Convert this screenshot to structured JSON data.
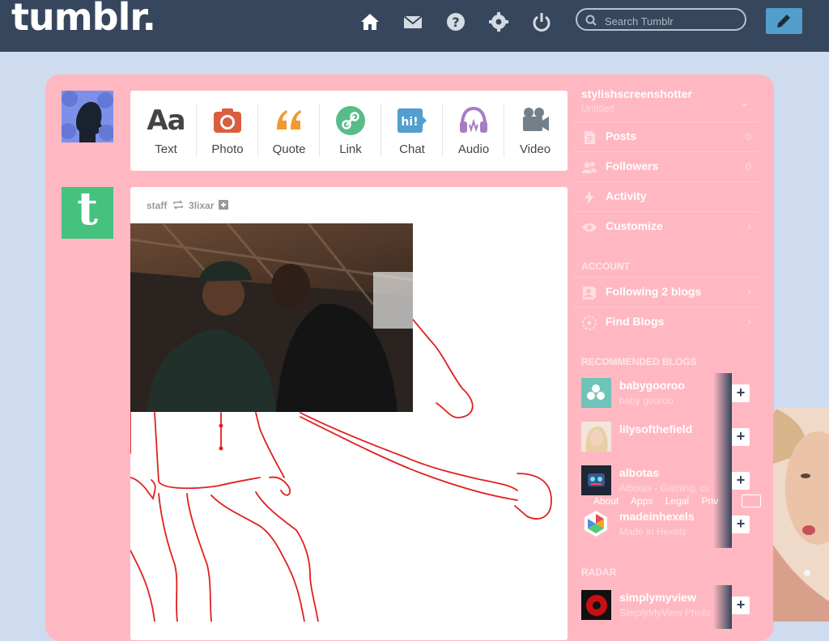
{
  "header": {
    "logo": "tumblr.",
    "nav_icons": [
      "home-icon",
      "mail-icon",
      "help-icon",
      "gear-icon",
      "power-icon"
    ],
    "search_placeholder": "Search Tumblr",
    "compose_icon": "pencil-icon"
  },
  "post_types": [
    {
      "label": "Text",
      "icon": "Aa",
      "color": "#444444"
    },
    {
      "label": "Photo",
      "icon": "camera-icon",
      "color": "#d95e40"
    },
    {
      "label": "Quote",
      "icon": "quote-icon",
      "color": "#f2992e"
    },
    {
      "label": "Link",
      "icon": "link-icon",
      "color": "#56bc8a"
    },
    {
      "label": "Chat",
      "icon": "chat-icon",
      "color": "#529ecc"
    },
    {
      "label": "Audio",
      "icon": "headphones-icon",
      "color": "#a77dc2"
    },
    {
      "label": "Video",
      "icon": "video-camera-icon",
      "color": "#748089"
    }
  ],
  "post": {
    "author": "staff",
    "reblogged_from": "3lixar",
    "avatar_letter": "t"
  },
  "sidebar": {
    "blog_name": "stylishscreenshotter",
    "blog_subtitle": "Untitled",
    "items": [
      {
        "label": "Posts",
        "count": "0",
        "icon": "document-icon"
      },
      {
        "label": "Followers",
        "count": "0",
        "icon": "people-icon"
      },
      {
        "label": "Activity",
        "count": "",
        "icon": "lightning-icon"
      },
      {
        "label": "Customize",
        "count": "",
        "icon": "eye-icon"
      }
    ],
    "account_title": "ACCOUNT",
    "account_items": [
      {
        "label": "Following 2 blogs",
        "icon": "following-icon"
      },
      {
        "label": "Find Blogs",
        "icon": "compass-icon"
      }
    ],
    "recommended_title": "RECOMMENDED BLOGS",
    "recommended": [
      {
        "name": "babygooroo",
        "desc": "baby gooroo",
        "color": "#6fc3b8"
      },
      {
        "name": "lilysofthefield",
        "desc": "",
        "color": "#e8cfa6"
      },
      {
        "name": "albotas",
        "desc": "Albotas - Gaming, cu",
        "color": "#1e2735"
      },
      {
        "name": "madeinhexels",
        "desc": "Made in Hexels",
        "color": "#ffffff"
      }
    ],
    "footer_links": [
      "About",
      "Apps",
      "Legal",
      "Priv"
    ],
    "radar_title": "RADAR",
    "radar": {
      "name": "simplymyview",
      "desc": "SimplyMyView Photo"
    }
  },
  "colors": {
    "nav_bg": "#36465d",
    "panel": "#ffb8c2",
    "page_bg": "#cfdcef"
  }
}
